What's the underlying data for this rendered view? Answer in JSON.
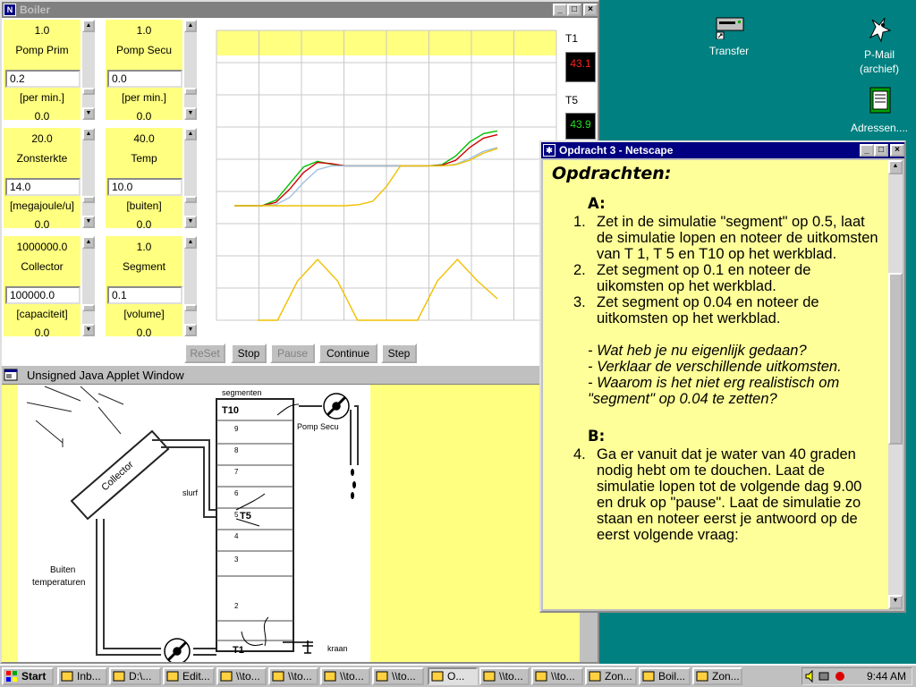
{
  "boiler_window": {
    "title": "Boiler",
    "controls": [
      {
        "top": "1.0",
        "name": "Pomp Prim",
        "input": "0.2",
        "unit": "[per min.]",
        "bottom": "0.0"
      },
      {
        "top": "1.0",
        "name": "Pomp Secu",
        "input": "0.0",
        "unit": "[per min.]",
        "bottom": "0.0"
      },
      {
        "top": "20.0",
        "name": "Zonsterkte",
        "input": "14.0",
        "unit": "[megajoule/u]",
        "bottom": "0.0"
      },
      {
        "top": "40.0",
        "name": "Temp",
        "input": "10.0",
        "unit": "[buiten]",
        "bottom": "0.0"
      },
      {
        "top": "1000000.0",
        "name": "Collector",
        "input": "100000.0",
        "unit": "[capaciteit]",
        "bottom": "0.0"
      },
      {
        "top": "1.0",
        "name": "Segment",
        "input": "0.1",
        "unit": "[volume]",
        "bottom": "0.0"
      }
    ],
    "buttons": {
      "reset": "ReSet",
      "stop": "Stop",
      "pause": "Pause",
      "continue": "Continue",
      "step": "Step"
    },
    "readouts": [
      {
        "label": "T1",
        "value": "43.1",
        "color": "#ff2020"
      },
      {
        "label": "T5",
        "value": "43.9",
        "color": "#20e020"
      }
    ],
    "applet_status": "Unsigned Java Applet Window"
  },
  "diagram": {
    "segmenten_label": "segmenten",
    "t10": "T10",
    "t5": "T5",
    "t1": "T1",
    "pomp_secu": "Pomp Secu",
    "collector": "Collector",
    "slurf": "slurf",
    "buiten_line1": "Buiten",
    "buiten_line2": "temperaturen",
    "kraan": "kraan",
    "segment_numbers": [
      "9",
      "8",
      "7",
      "6",
      "5",
      "4",
      "3",
      "2"
    ]
  },
  "chart_data": {
    "type": "line",
    "title": "",
    "xlabel": "",
    "ylabel": "",
    "grid": true,
    "series": [
      {
        "color": "#00c000",
        "values": [
          0,
          0,
          0,
          0.1,
          0.4,
          0.7,
          0.8,
          0.75,
          0.72,
          0.72,
          0.72,
          0.72,
          0.72,
          0.72,
          0.72,
          0.74,
          0.9,
          1.15,
          1.3,
          1.35
        ]
      },
      {
        "color": "#d00000",
        "values": [
          0,
          0,
          0,
          0.06,
          0.3,
          0.6,
          0.78,
          0.76,
          0.72,
          0.72,
          0.72,
          0.72,
          0.72,
          0.72,
          0.72,
          0.73,
          0.82,
          1.05,
          1.22,
          1.28
        ]
      },
      {
        "color": "#a0c0e0",
        "values": [
          0,
          0,
          0,
          0.02,
          0.15,
          0.42,
          0.65,
          0.72,
          0.72,
          0.72,
          0.72,
          0.72,
          0.72,
          0.72,
          0.72,
          0.72,
          0.75,
          0.85,
          0.98,
          1.05
        ]
      },
      {
        "color": "#f0c000",
        "values": [
          0,
          0,
          0,
          0,
          0,
          0,
          0,
          0,
          0,
          0.02,
          0.08,
          0.35,
          0.72,
          0.72,
          0.72,
          0.72,
          0.74,
          0.82,
          0.95,
          1.03
        ]
      }
    ],
    "sun": {
      "color": "#f0c000",
      "values": [
        0,
        0,
        0.55,
        0.85,
        0.55,
        0,
        0,
        0,
        0,
        0.55,
        0.85,
        0.55,
        0.3
      ]
    }
  },
  "netscape_window": {
    "title": "Opdracht 3 - Netscape",
    "heading": "Opdrachten:",
    "section_a": "A:",
    "items_a": [
      {
        "num": "1.",
        "text": "Zet in de simulatie \"segment\" op 0.5, laat de simulatie lopen en noteer de uitkomsten van T 1, T 5 en T10 op het werkblad."
      },
      {
        "num": "2.",
        "text": "Zet segment op 0.1 en noteer de uikomsten op het werkblad."
      },
      {
        "num": "3.",
        "text": "Zet segment op 0.04 en noteer de uitkomsten op het werkblad."
      }
    ],
    "questions": [
      "- Wat heb je nu eigenlijk gedaan?",
      "- Verklaar de verschillende uitkomsten.",
      "- Waarom is het niet erg realistisch om \"segment\" op 0.04 te zetten?"
    ],
    "section_b": "B:",
    "items_b": [
      {
        "num": "4.",
        "text": "Ga er vanuit dat je water van 40 graden nodig hebt om te douchen. Laat de simulatie lopen tot de volgende dag 9.00 en druk op \"pause\". Laat de simulatie zo staan en noteer eerst je antwoord op de eerst volgende vraag:"
      }
    ]
  },
  "desktop_icons": [
    {
      "label": "Transfer",
      "icon": "drive-icon"
    },
    {
      "label": "P-Mail (archief)",
      "icon": "pegasus-icon"
    },
    {
      "label": "Adressen....",
      "icon": "notepad-icon"
    }
  ],
  "taskbar": {
    "start": "Start",
    "tasks": [
      "Inb...",
      "D:\\...",
      "Edit...",
      "\\\\to...",
      "\\\\to...",
      "\\\\to...",
      "\\\\to...",
      "O...",
      "\\\\to...",
      "\\\\to...",
      "Zon...",
      "Boil...",
      "Zon..."
    ],
    "clock": "9:44 AM"
  }
}
